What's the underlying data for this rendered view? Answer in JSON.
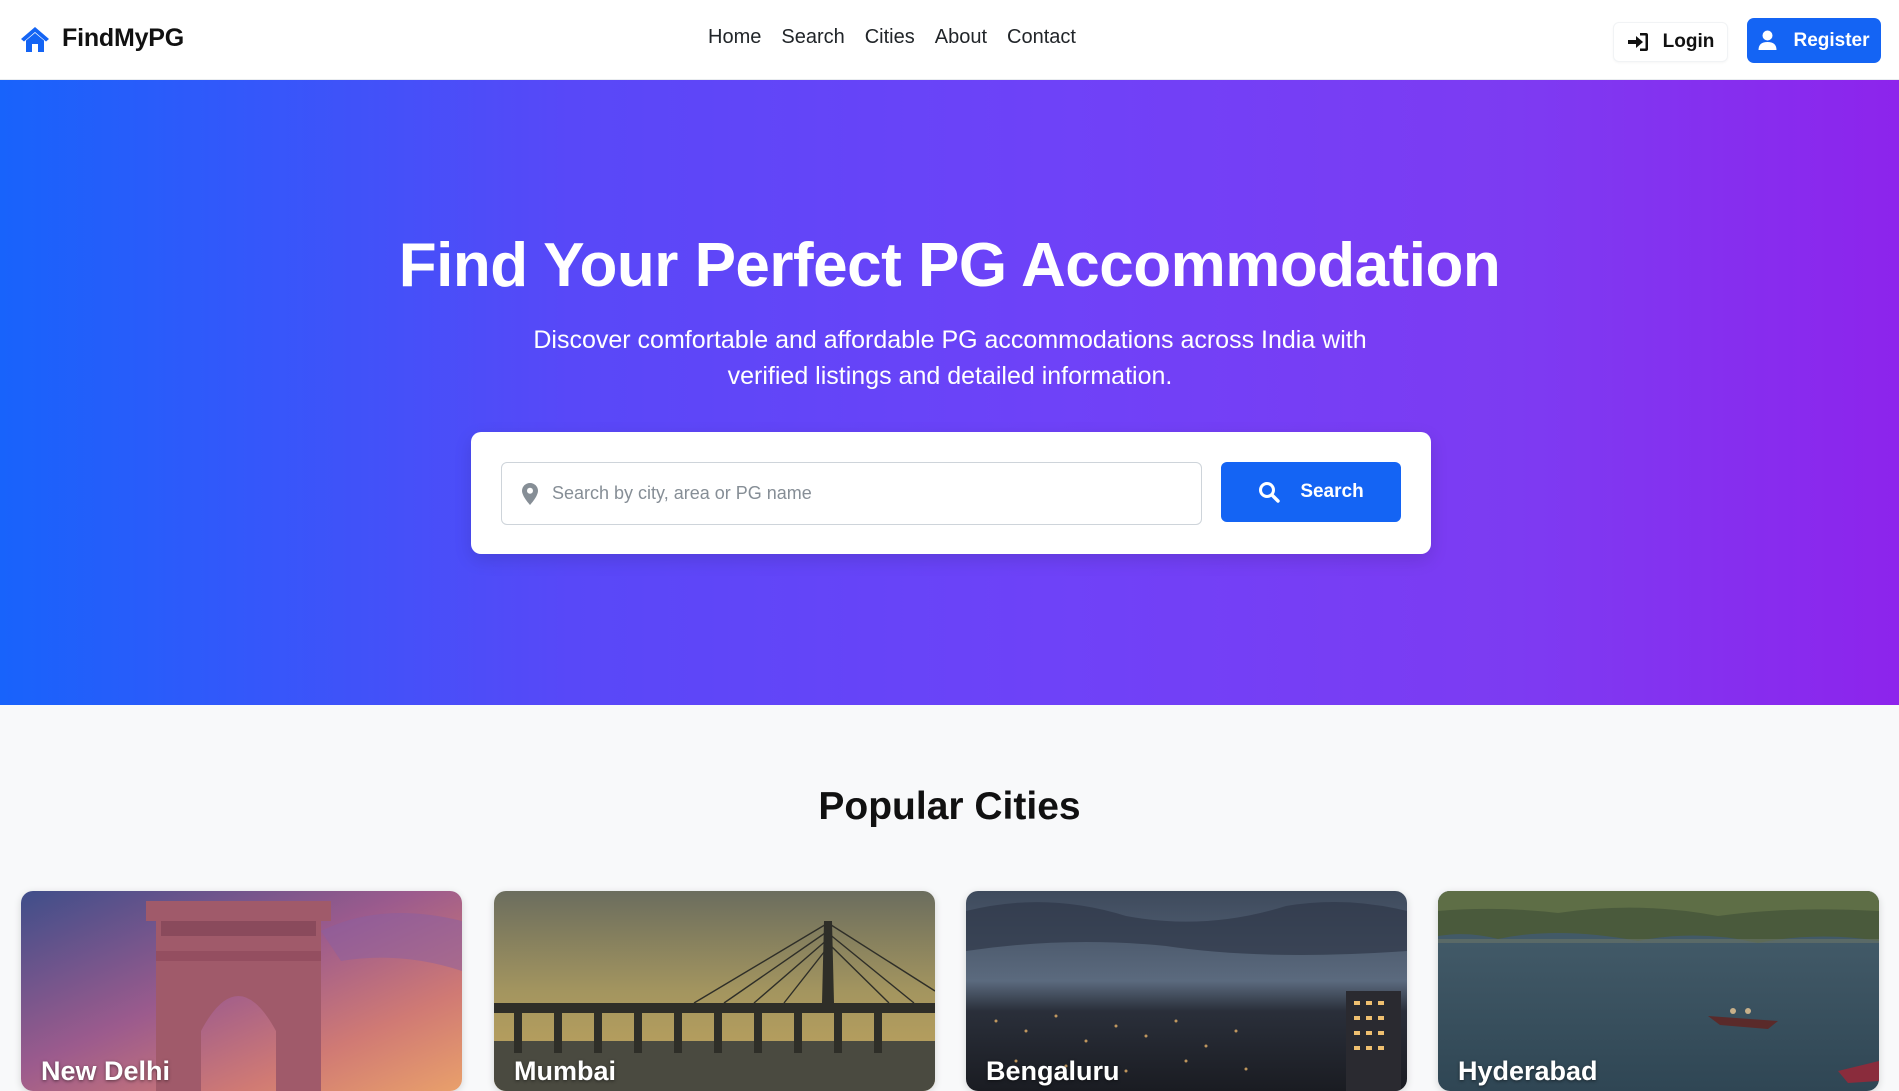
{
  "brand": {
    "name": "FindMyPG",
    "icon": "house-icon",
    "accent": "#1464f4"
  },
  "nav": {
    "links": [
      {
        "label": "Home"
      },
      {
        "label": "Search"
      },
      {
        "label": "Cities"
      },
      {
        "label": "About"
      },
      {
        "label": "Contact"
      }
    ],
    "login_label": "Login",
    "register_label": "Register"
  },
  "hero": {
    "title": "Find Your Perfect PG Accommodation",
    "subtitle": "Discover comfortable and affordable PG accommodations across India with verified listings and detailed information.",
    "gradient": [
      "#1863fb",
      "#8d24ec"
    ],
    "search": {
      "placeholder": "Search by city, area or PG name",
      "value": "",
      "button_label": "Search"
    }
  },
  "popular": {
    "title": "Popular Cities",
    "cities": [
      {
        "name": "New Delhi"
      },
      {
        "name": "Mumbai"
      },
      {
        "name": "Bengaluru"
      },
      {
        "name": "Hyderabad"
      }
    ]
  }
}
